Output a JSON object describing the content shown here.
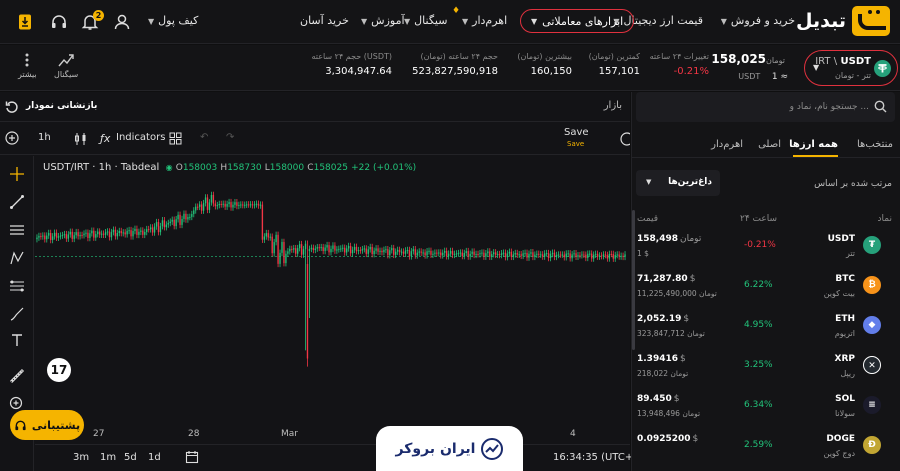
{
  "nav": {
    "logo": "تبدیل",
    "items": [
      {
        "label": "خرید و فروش",
        "dropdown": true
      },
      {
        "label": "قیمت ارز دیجیتال",
        "dropdown": true
      },
      {
        "label": "ابزارهای معاملاتی",
        "dropdown": true,
        "highlighted": true
      },
      {
        "label": "اهرم‌دار",
        "dropdown": true
      },
      {
        "label": "سیگنال",
        "dropdown": true
      },
      {
        "label": "آموزش",
        "dropdown": true
      },
      {
        "label": "خرید آسان",
        "dropdown": false
      }
    ],
    "wallet": "کیف پول",
    "notification_count": "2",
    "icons": [
      "user-icon",
      "bell-icon",
      "headset-icon",
      "download-app-icon"
    ]
  },
  "ticker": {
    "pair": "USDT",
    "pair_quote": "IRT \\",
    "pair_sub": "تتر - تومان",
    "price": "158,025",
    "price_unit": "تومان",
    "price_usd": "1",
    "price_usd_prefix": "≈",
    "price_usd_unit": "USDT",
    "stats": [
      {
        "label": "تغییرات ۲۴ ساعته",
        "value": "-0.21%"
      },
      {
        "label": "کمترین (تومان)",
        "value": "157,101"
      },
      {
        "label": "بیشترین (تومان)",
        "value": "160,150"
      },
      {
        "label": "حجم ۲۴ ساعته (تومان)",
        "value": "523,827,590,918"
      },
      {
        "label": "حجم ۲۴ ساعته (USDT)",
        "value": "3,304,947.64"
      }
    ],
    "tools": [
      {
        "label": "سیگنال"
      },
      {
        "label": "بیشتر"
      }
    ]
  },
  "chart_panel": {
    "title": "بازار",
    "reset_label": "بازنشانی نمودار",
    "interval": "1h",
    "indicators": "Indicators",
    "save": "Save",
    "save_sub": "Save",
    "legend_symbol": "USDT/IRT · 1h · Tabdeal",
    "legend_o_key": "O",
    "legend_o": "158003",
    "legend_h_key": "H",
    "legend_h": "158730",
    "legend_l_key": "L",
    "legend_l": "158000",
    "legend_c_key": "C",
    "legend_c": "158025",
    "legend_chg": "+22 (+0.01%)",
    "xticks": [
      "27",
      "28",
      "Mar",
      "2",
      "3",
      "4"
    ],
    "timeframes": [
      "3m",
      "1m",
      "5d",
      "1d"
    ],
    "clock": "16:34:35 (UTC+3:",
    "support": "پشتیبانی",
    "watermark": "ایران بروکر"
  },
  "market": {
    "search_placeholder": "جستجو نام، نماد و ...",
    "tabs": [
      "منتخب‌ها",
      "همه ارزها",
      "اصلی",
      "اهرم‌دار"
    ],
    "active_tab": "همه ارزها",
    "sort_label": "مرتب شده بر اساس",
    "sort_value": "داغ‌ترین‌ها",
    "col_symbol": "نماد",
    "col_change": "۲۴ ساعت",
    "col_price": "قیمت",
    "rows": [
      {
        "sym": "USDT",
        "fa": "تتر",
        "icon": "tether-icon",
        "color": "#26a17b",
        "change": "-0.21%",
        "dir": "down",
        "price": "158,498",
        "price_cur": "تومان",
        "price2": "1 $"
      },
      {
        "sym": "BTC",
        "fa": "بیت کوین",
        "icon": "bitcoin-icon",
        "color": "#f7931a",
        "change": "6.22%",
        "dir": "up",
        "price": "71,287.80",
        "price_cur": "$",
        "price2": "11,225,490,000 تومان"
      },
      {
        "sym": "ETH",
        "fa": "اتریوم",
        "icon": "ethereum-icon",
        "color": "#627eea",
        "change": "4.95%",
        "dir": "up",
        "price": "2,052.19",
        "price_cur": "$",
        "price2": "323,847,712 تومان"
      },
      {
        "sym": "XRP",
        "fa": "ریپل",
        "icon": "xrp-icon",
        "color": "#23292f",
        "change": "3.25%",
        "dir": "up",
        "price": "1.39416",
        "price_cur": "$",
        "price2": "218,022 تومان"
      },
      {
        "sym": "SOL",
        "fa": "سولانا",
        "icon": "solana-icon",
        "color": "#1b1b2b",
        "change": "6.34%",
        "dir": "up",
        "price": "89.450",
        "price_cur": "$",
        "price2": "13,948,496 تومان"
      },
      {
        "sym": "DOGE",
        "fa": "دوج کوین",
        "icon": "doge-icon",
        "color": "#c2a633",
        "change": "2.59%",
        "dir": "up",
        "price": "0.0925200",
        "price_cur": "$",
        "price2": ""
      }
    ]
  },
  "colors": {
    "accent": "#f5b400",
    "up": "#22c37a",
    "down": "#f23645",
    "highlight_border": "#e0313e"
  }
}
